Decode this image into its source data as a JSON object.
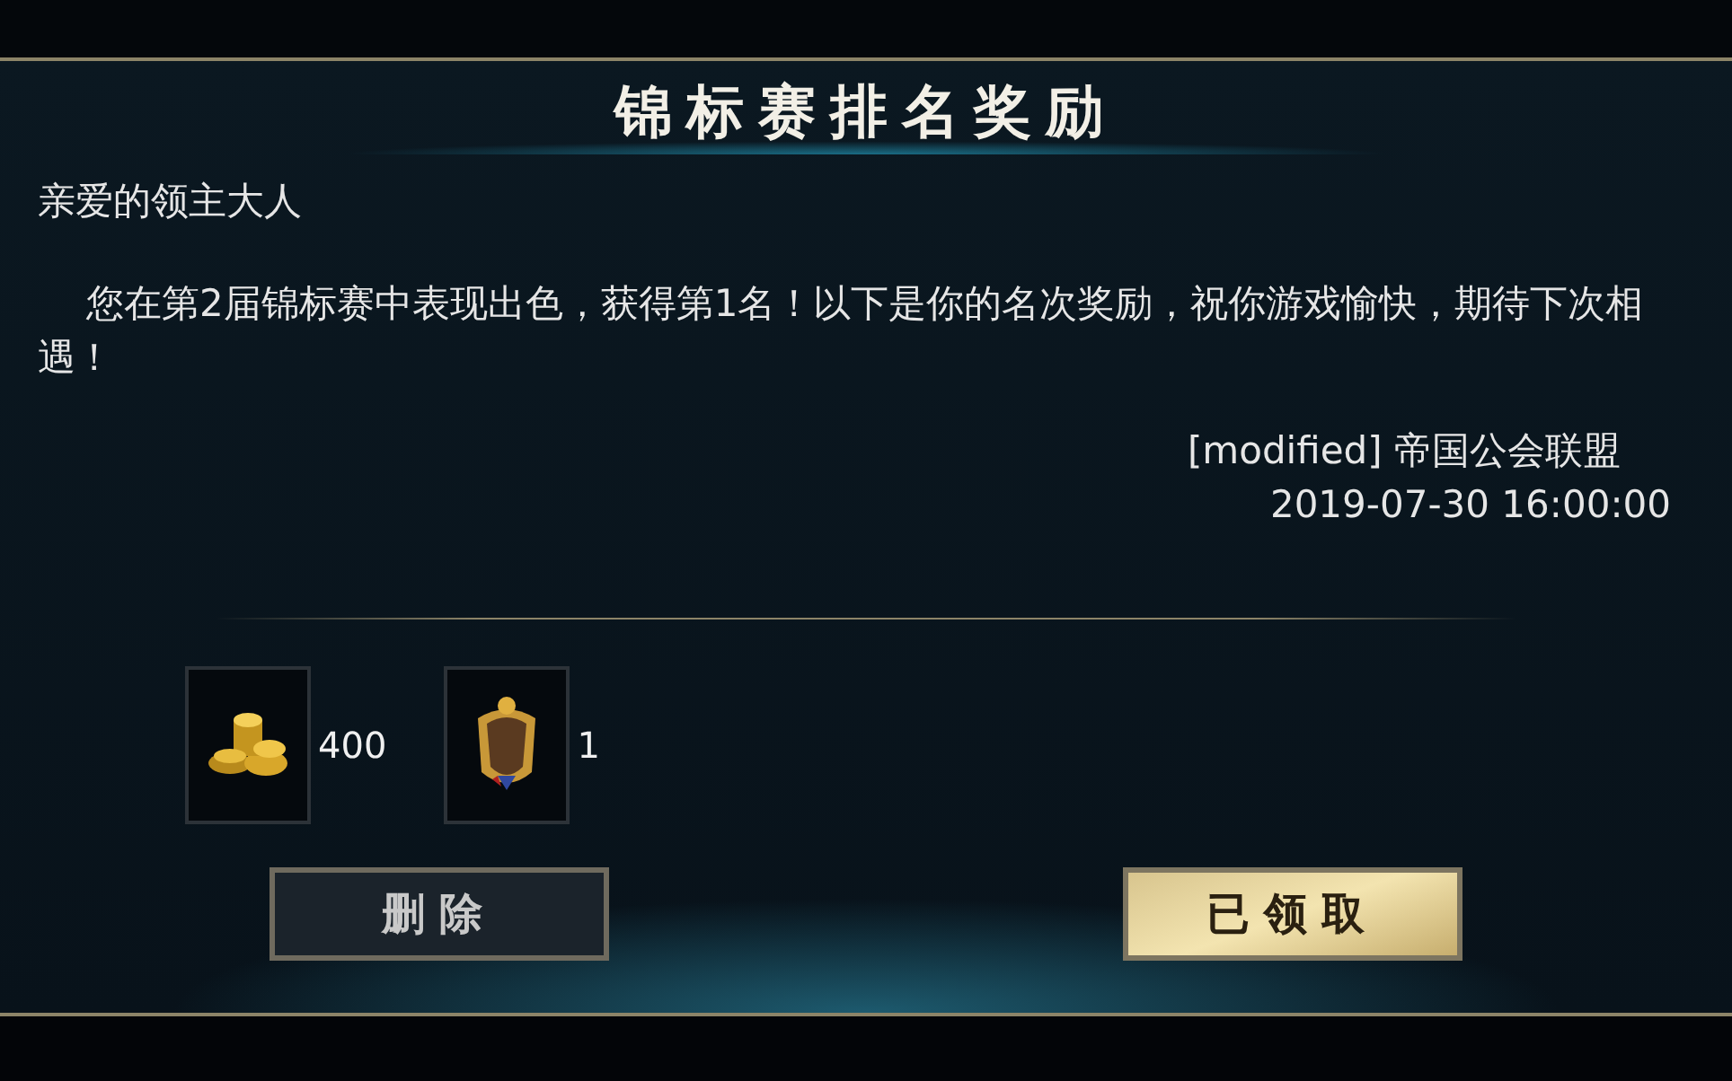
{
  "dialog": {
    "title": "锦标赛排名奖励"
  },
  "mail": {
    "greeting": "亲爱的领主大人",
    "body": "您在第2届锦标赛中表现出色，获得第1名！以下是你的名次奖励，祝你游戏愉快，期待下次相遇！",
    "sender": "[modified] 帝国公会联盟",
    "date": "2019-07-30 16:00:00"
  },
  "rewards": [
    {
      "kind": "coins",
      "count": "400"
    },
    {
      "kind": "crest",
      "count": "1"
    }
  ],
  "buttons": [
    {
      "label": "删除",
      "kind": "dark"
    },
    {
      "label": "已领取",
      "kind": "gold"
    }
  ]
}
